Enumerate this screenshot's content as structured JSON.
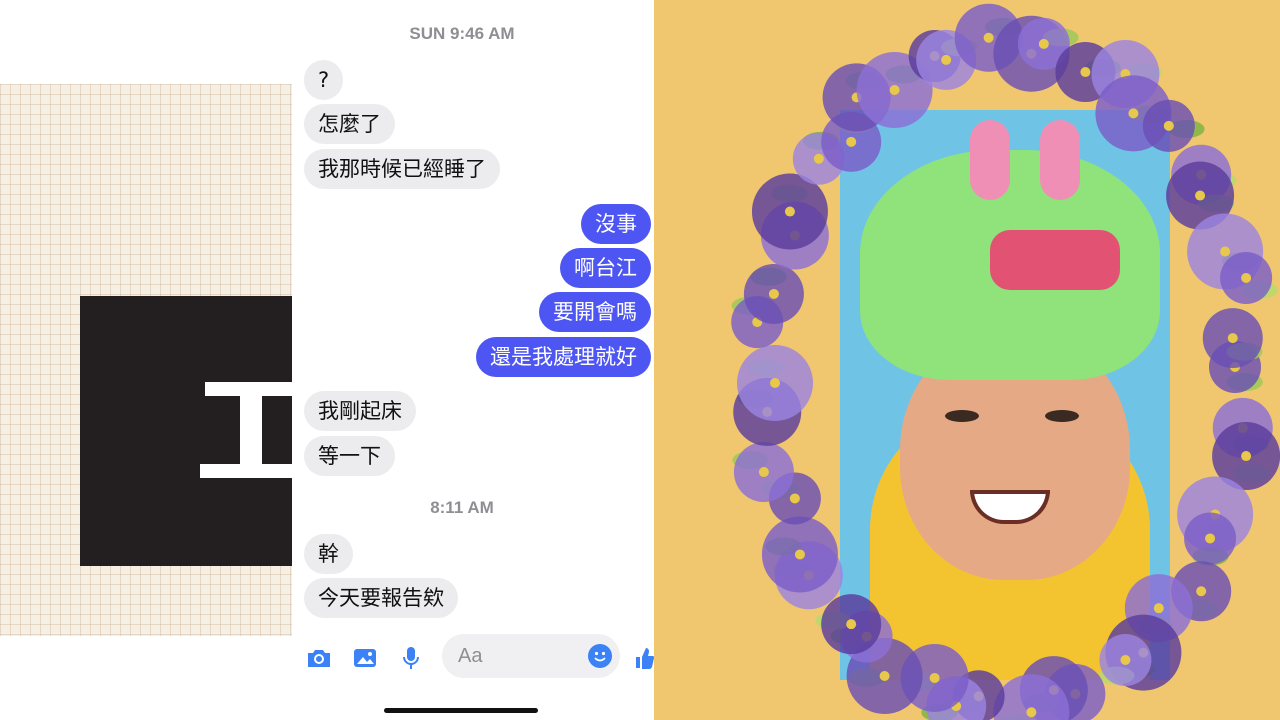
{
  "conversation": {
    "timestamps": [
      "SUN 9:46 AM",
      "8:11 AM"
    ],
    "messages": [
      {
        "side": "in",
        "text": "?"
      },
      {
        "side": "in",
        "text": "怎麼了"
      },
      {
        "side": "in",
        "text": "我那時候已經睡了"
      },
      {
        "side": "out",
        "text": "沒事"
      },
      {
        "side": "out",
        "text": "啊台江"
      },
      {
        "side": "out",
        "text": "要開會嗎"
      },
      {
        "side": "out",
        "text": "還是我處理就好"
      },
      {
        "side": "in",
        "text": "我剛起床"
      },
      {
        "side": "in",
        "text": "等一下"
      },
      {
        "side": "in",
        "text": "幹"
      },
      {
        "side": "in",
        "text": "今天要報告欸"
      }
    ]
  },
  "composer": {
    "placeholder": "Aa",
    "icons": [
      "camera-icon",
      "image-icon",
      "microphone-icon",
      "emoji-icon",
      "thumbs-up-icon"
    ]
  },
  "colors": {
    "outgoing_bubble": "#4d55f2",
    "incoming_bubble": "#ececee",
    "accent_blue": "#3b82f6",
    "memorial_background": "#f0c66e",
    "slide_black": "#231f20"
  }
}
